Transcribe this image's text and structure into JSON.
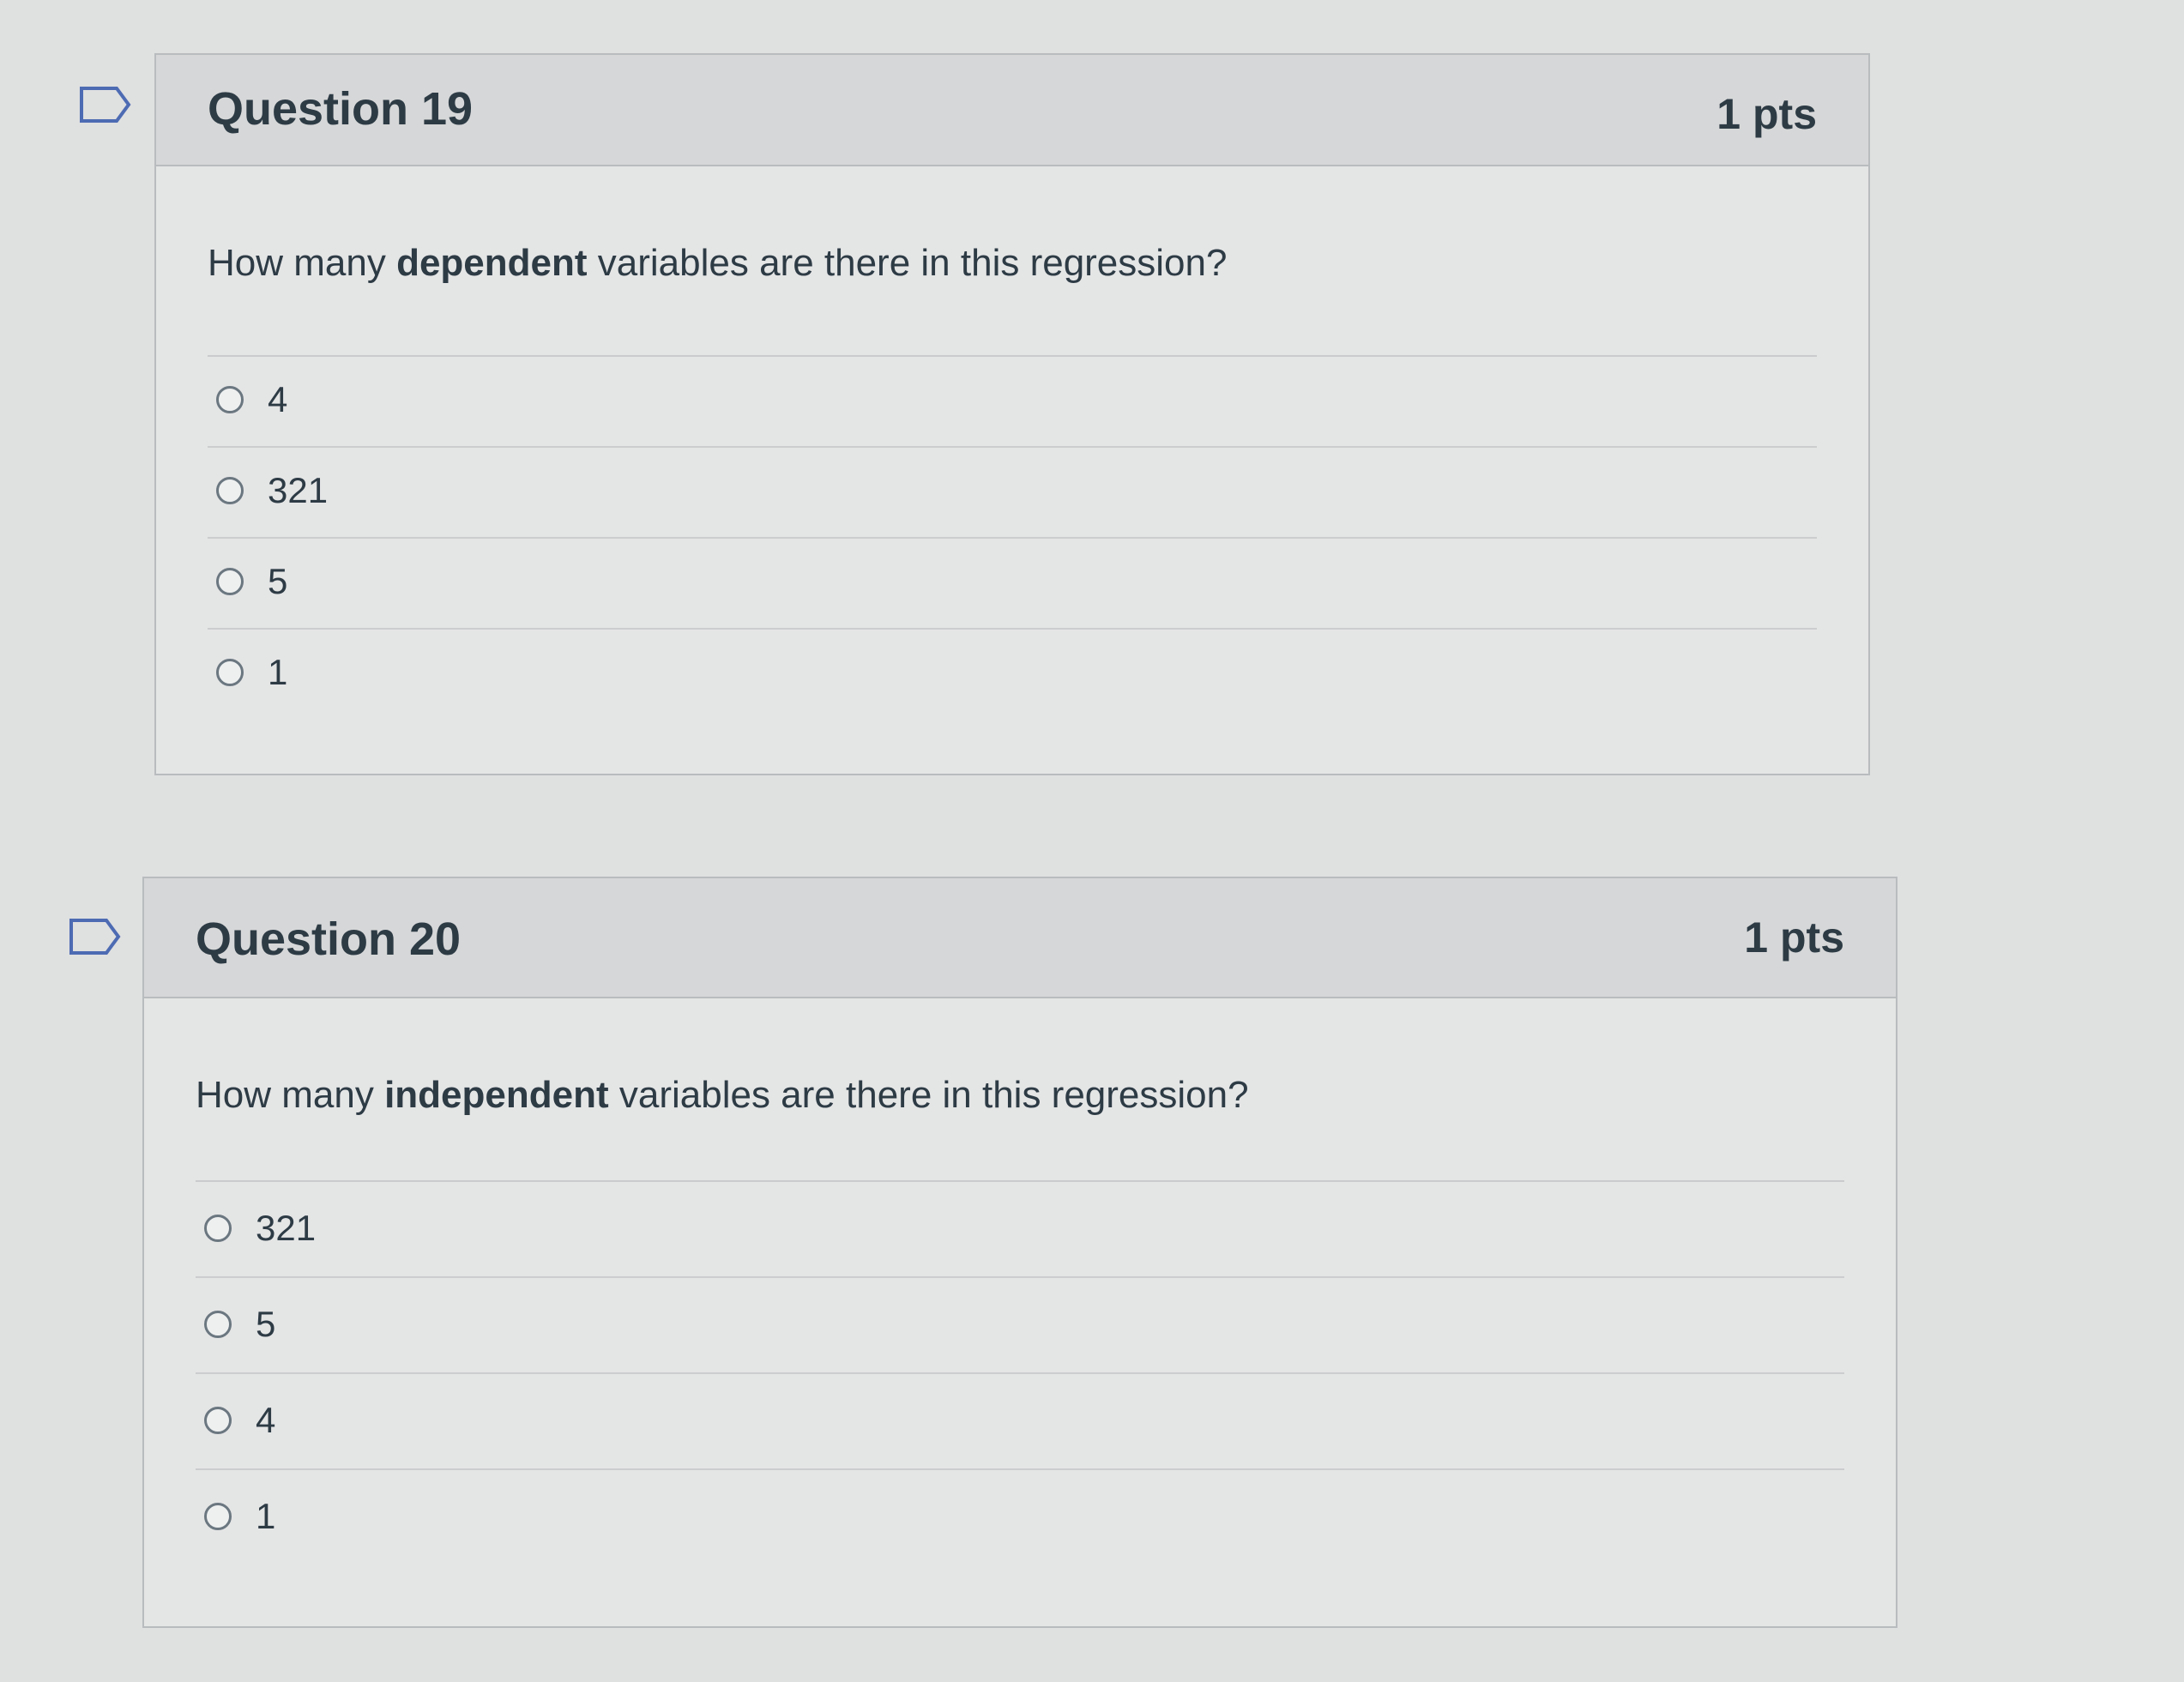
{
  "questions": [
    {
      "title": "Question 19",
      "points": "1 pts",
      "text_before": "How many ",
      "text_bold": "dependent",
      "text_after": " variables are there in this regression?",
      "answers": [
        "4",
        "321",
        "5",
        "1"
      ]
    },
    {
      "title": "Question 20",
      "points": "1 pts",
      "text_before": "How many ",
      "text_bold": "independent",
      "text_after": " variables are there in this regression?",
      "answers": [
        "321",
        "5",
        "4",
        "1"
      ]
    }
  ],
  "icons": {
    "flag": "bookmark-flag-icon",
    "radio": "radio-unselected-icon"
  },
  "colors": {
    "card_border": "#b9bcbe",
    "header_bg": "#d6d7d8",
    "text": "#2d3b45"
  }
}
